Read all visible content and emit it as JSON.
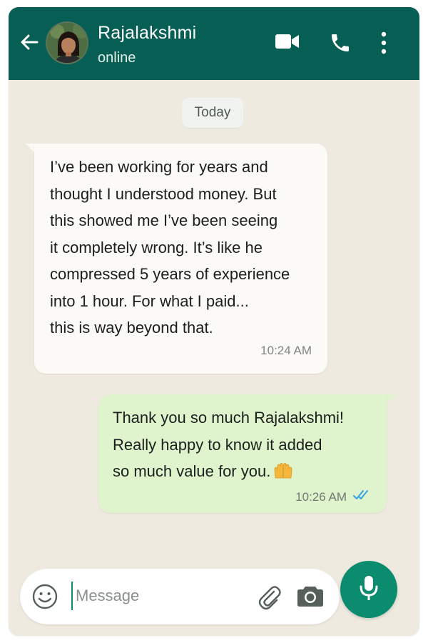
{
  "header": {
    "contact_name": "Rajalakshmi",
    "status": "online",
    "icons": [
      "back-arrow-icon",
      "video-call-icon",
      "phone-icon",
      "more-vert-icon"
    ]
  },
  "chat": {
    "date_label": "Today",
    "messages": [
      {
        "direction": "incoming",
        "text": "I’ve been working for years and\nthought I understood money. But\nthis showed me I’ve been seeing\nit completely wrong. It’s like he\ncompressed 5 years of experience\ninto 1 hour. For what I paid...\nthis is way beyond that.",
        "time": "10:24 AM"
      },
      {
        "direction": "outgoing",
        "text": "Thank you so much Rajalakshmi!\nReally happy to know it added\nso much value for you.",
        "emoji": "raising-hands-emoji",
        "time": "10:26 AM",
        "status": "read"
      }
    ]
  },
  "composer": {
    "placeholder": "Message",
    "icons": [
      "smiley-icon",
      "paperclip-icon",
      "camera-icon",
      "mic-icon"
    ]
  },
  "colors": {
    "header": "#075e54",
    "chat_background": "#efeae0",
    "incoming_bubble": "#fbfaf7",
    "outgoing_bubble": "#dff4cd",
    "read_ticks": "#34a3e0",
    "mic_button": "#0b8c6e"
  }
}
